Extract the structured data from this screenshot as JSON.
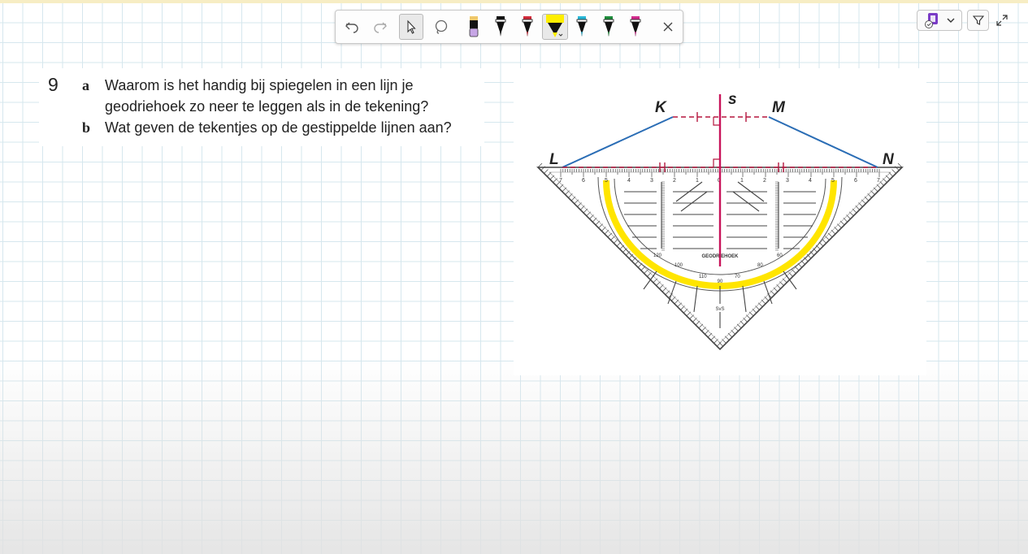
{
  "toolbar": {
    "tools": [
      {
        "name": "undo-icon"
      },
      {
        "name": "redo-icon"
      },
      {
        "name": "pointer-icon",
        "selected": true
      },
      {
        "name": "lasso-icon"
      },
      {
        "name": "pen-black-purple",
        "color": "#b59ad6"
      },
      {
        "name": "pen-black",
        "color": "#111111"
      },
      {
        "name": "pen-red",
        "color": "#d02a3a"
      },
      {
        "name": "highlighter-yellow",
        "color": "#ffee00",
        "selected": true
      },
      {
        "name": "pen-cyan",
        "color": "#27b6d6"
      },
      {
        "name": "pen-green",
        "color": "#1e8c3c"
      },
      {
        "name": "pen-magenta",
        "color": "#d12c8c"
      },
      {
        "name": "close-icon"
      }
    ]
  },
  "question": {
    "number": "9",
    "a_letter": "a",
    "a_line1": "Waarom is het handig bij spiegelen in een lijn je",
    "a_line2": "geodriehoek zo neer te leggen als in de tekening?",
    "b_letter": "b",
    "b_text": "Wat geven de tekentjes op de gestippelde lijnen aan?"
  },
  "figure": {
    "labels": {
      "K": "K",
      "s": "s",
      "M": "M",
      "L": "L",
      "N": "N"
    },
    "brand": "GEODRIEHOEK",
    "brand_small": "SvS",
    "scale_left": [
      "7",
      "6",
      "5",
      "4",
      "3",
      "2",
      "1"
    ],
    "scale_right": [
      "1",
      "2",
      "3",
      "4",
      "5",
      "6",
      "7"
    ],
    "center_zero": "0",
    "angle_90": "90",
    "colors": {
      "line_blue": "#2a6db5",
      "dotted": "#b5173f",
      "mirror": "#c8145a",
      "protractor_arc": "#ffe500"
    }
  }
}
